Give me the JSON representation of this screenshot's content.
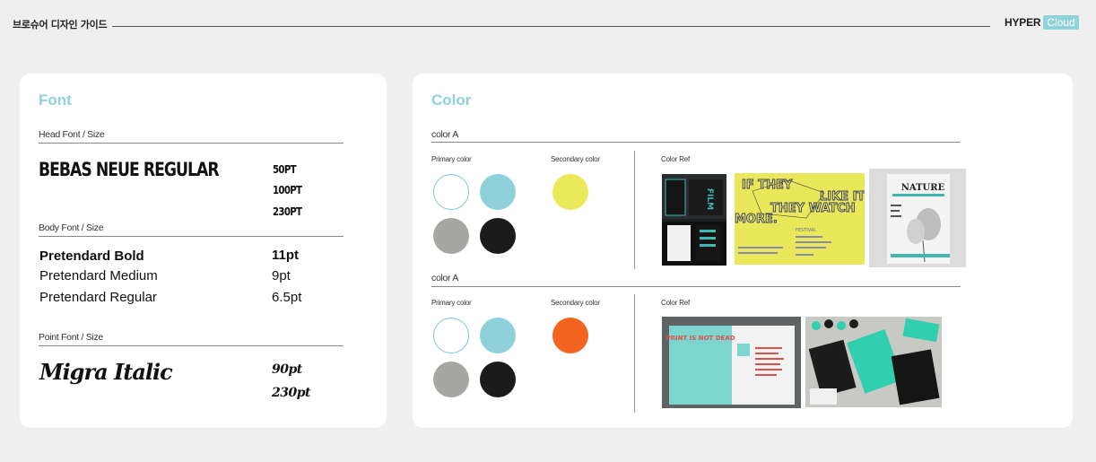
{
  "header": {
    "title": "브로슈어 디자인 가이드",
    "brand_primary": "HYPER",
    "brand_secondary": "Cloud"
  },
  "font_panel": {
    "title": "Font",
    "head": {
      "label": "Head Font / Size",
      "font_name": "BEBAS NEUE REGULAR",
      "sizes": [
        "50PT",
        "100PT",
        "230PT"
      ]
    },
    "body": {
      "label": "Body Font / Size",
      "fonts": [
        "Pretendard Bold",
        "Pretendard Medium",
        "Pretendard Regular"
      ],
      "sizes": [
        "11pt",
        "9pt",
        "6.5pt"
      ]
    },
    "point": {
      "label": "Point Font / Size",
      "font_name": "Migra Italic",
      "sizes": [
        "90pt",
        "230pt"
      ]
    }
  },
  "color_panel": {
    "title": "Color",
    "sets": [
      {
        "label": "color A",
        "primary_label": "Primary color",
        "secondary_label": "Secondary color",
        "ref_label": "Color Ref",
        "primary_colors": [
          "#ffffff",
          "#8ed1da",
          "#a6a6a2",
          "#1b1b1b"
        ],
        "secondary_colors": [
          "#ebe85a"
        ]
      },
      {
        "label": "color A",
        "primary_label": "Primary color",
        "secondary_label": "Secondary color",
        "ref_label": "Color Ref",
        "primary_colors": [
          "#ffffff",
          "#8ed1da",
          "#a6a6a2",
          "#1b1b1b"
        ],
        "secondary_colors": [
          "#f2641f"
        ]
      }
    ],
    "ref_images": {
      "poster_text_1": "IF THEY",
      "poster_text_2": "THEY WATCH",
      "poster_text_3": "LIKE IT",
      "poster_text_4": "MORE.",
      "poster_small": "FESTIVAL",
      "magazine_title": "NATURE",
      "book_title": "FILM",
      "spread_title": "PRINT IS NOT DEAD"
    }
  }
}
